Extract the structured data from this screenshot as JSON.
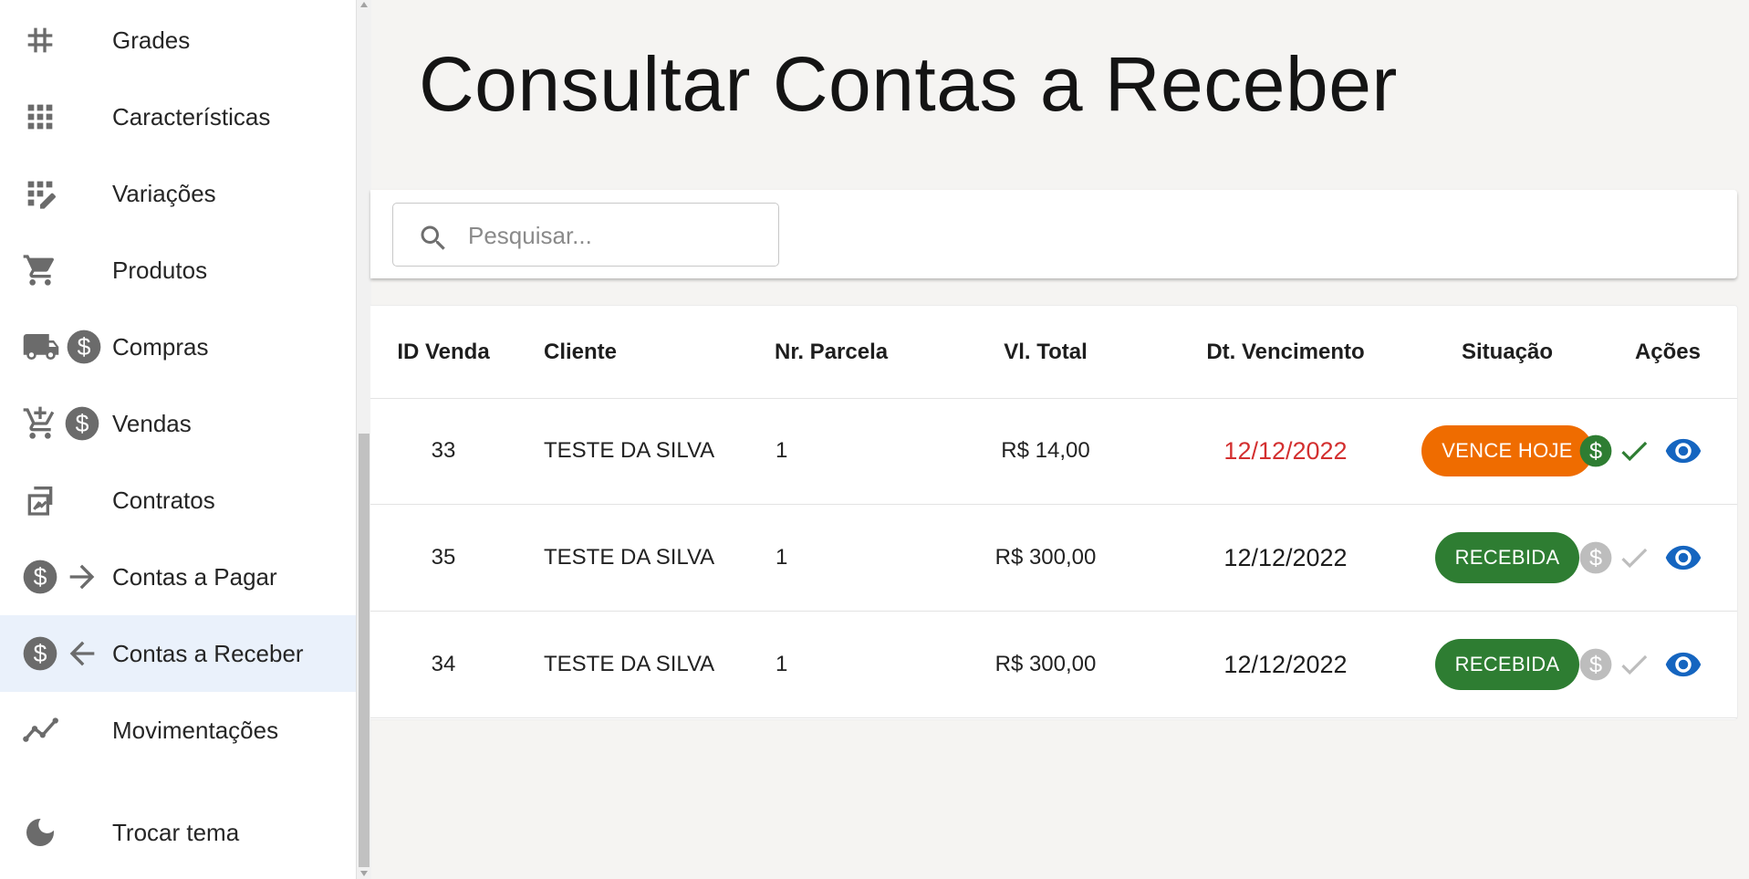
{
  "sidebar": {
    "items": [
      {
        "label": "Grades",
        "icons": [
          "hashtag-icon"
        ]
      },
      {
        "label": "Características",
        "icons": [
          "grid-icon"
        ]
      },
      {
        "label": "Variações",
        "icons": [
          "grid-edit-icon"
        ]
      },
      {
        "label": "Produtos",
        "icons": [
          "shopping-cart-icon"
        ]
      },
      {
        "label": "Compras",
        "icons": [
          "truck-icon",
          "dollar-circle-icon"
        ]
      },
      {
        "label": "Vendas",
        "icons": [
          "cart-add-icon",
          "dollar-circle-icon"
        ]
      },
      {
        "label": "Contratos",
        "icons": [
          "contract-sign-icon"
        ]
      },
      {
        "label": "Contas a Pagar",
        "icons": [
          "dollar-circle-icon",
          "arrow-right-icon"
        ]
      },
      {
        "label": "Contas a Receber",
        "icons": [
          "dollar-circle-icon",
          "arrow-left-icon"
        ],
        "active": true
      },
      {
        "label": "Movimentações",
        "icons": [
          "trending-line-icon"
        ]
      }
    ],
    "theme_toggle": {
      "label": "Trocar tema",
      "icon": "moon-icon"
    }
  },
  "page": {
    "title": "Consultar Contas a Receber"
  },
  "search": {
    "placeholder": "Pesquisar...",
    "value": "",
    "icon": "search-icon"
  },
  "table": {
    "headers": {
      "id": "ID Venda",
      "client": "Cliente",
      "installment": "Nr. Parcela",
      "total": "Vl. Total",
      "due": "Dt. Vencimento",
      "status": "Situação",
      "actions": "Ações"
    },
    "rows": [
      {
        "id": "33",
        "client": "TESTE DA SILVA",
        "installment": "1",
        "total": "R$ 14,00",
        "due": "12/12/2022",
        "status": "VENCE HOJE",
        "status_color": "#ef6c00",
        "due_color": "#d32f2f",
        "actions_enabled": true
      },
      {
        "id": "35",
        "client": "TESTE DA SILVA",
        "installment": "1",
        "total": "R$ 300,00",
        "due": "12/12/2022",
        "status": "RECEBIDA",
        "status_color": "#2e7d32",
        "due_color": "#1d1d1d",
        "actions_enabled": false
      },
      {
        "id": "34",
        "client": "TESTE DA SILVA",
        "installment": "1",
        "total": "R$ 300,00",
        "due": "12/12/2022",
        "status": "RECEBIDA",
        "status_color": "#2e7d32",
        "due_color": "#1d1d1d",
        "actions_enabled": false
      }
    ]
  },
  "colors": {
    "active_nav_bg": "#eaf1fb",
    "icon_gray": "#6b6b6b",
    "eye_blue": "#1565c0",
    "pay_green": "#2e7d32",
    "disabled_gray": "#bdbdbd",
    "vence_hoje": "#ef6c00",
    "recebida": "#2e7d32"
  }
}
